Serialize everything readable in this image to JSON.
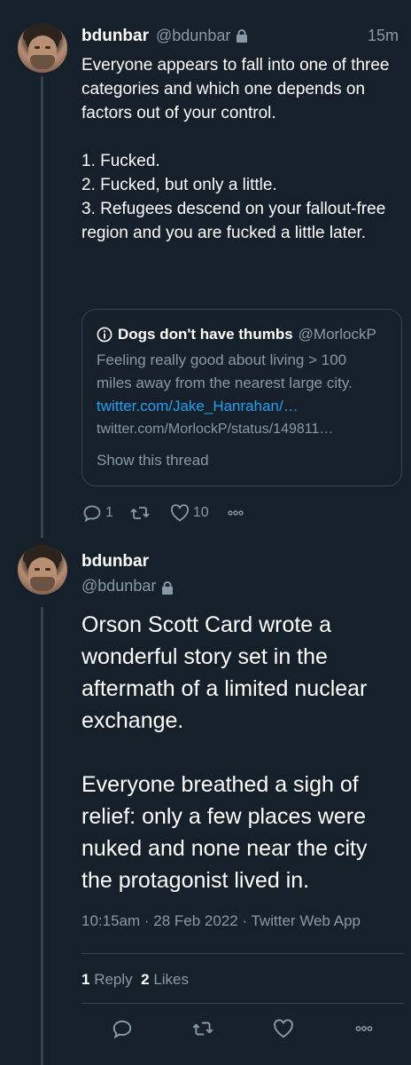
{
  "tweet1": {
    "name": "bdunbar",
    "handle": "@bdunbar",
    "time": "15m",
    "text": "Everyone appears to fall into one of three categories and which one depends on factors out of your control.\n\n1. Fucked.\n2. Fucked, but only a little.\n3. Refugees descend on your fallout-free region and you are fucked a little later.",
    "quote": {
      "name": "Dogs don't have thumbs",
      "handle": "@MorlockP",
      "text": "Feeling really good about living > 100 miles away from the nearest large city. ",
      "link": "twitter.com/Jake_Hanrahan/…",
      "url": "twitter.com/MorlockP/status/149811…",
      "show_thread": "Show this thread"
    },
    "actions": {
      "replies": "1",
      "retweets": "",
      "likes": "10"
    }
  },
  "tweet2": {
    "name": "bdunbar",
    "handle": "@bdunbar",
    "text": "Orson Scott Card wrote a wonderful story set in the aftermath of a limited nuclear exchange.\n\nEveryone breathed a sigh of relief: only a few places were nuked and none near the city the protagonist lived in.",
    "meta": "10:15am · 28 Feb 2022 · Twitter Web App",
    "stats": {
      "reply_count": "1",
      "reply_label": "Reply",
      "like_count": "2",
      "like_label": "Likes"
    }
  },
  "colors": {
    "background": "#15202b",
    "text_secondary": "#8899a6",
    "link": "#1da1f2",
    "border": "#38444d"
  },
  "icons": [
    "lock-icon",
    "info-icon",
    "reply-icon",
    "retweet-icon",
    "like-icon",
    "more-icon"
  ]
}
